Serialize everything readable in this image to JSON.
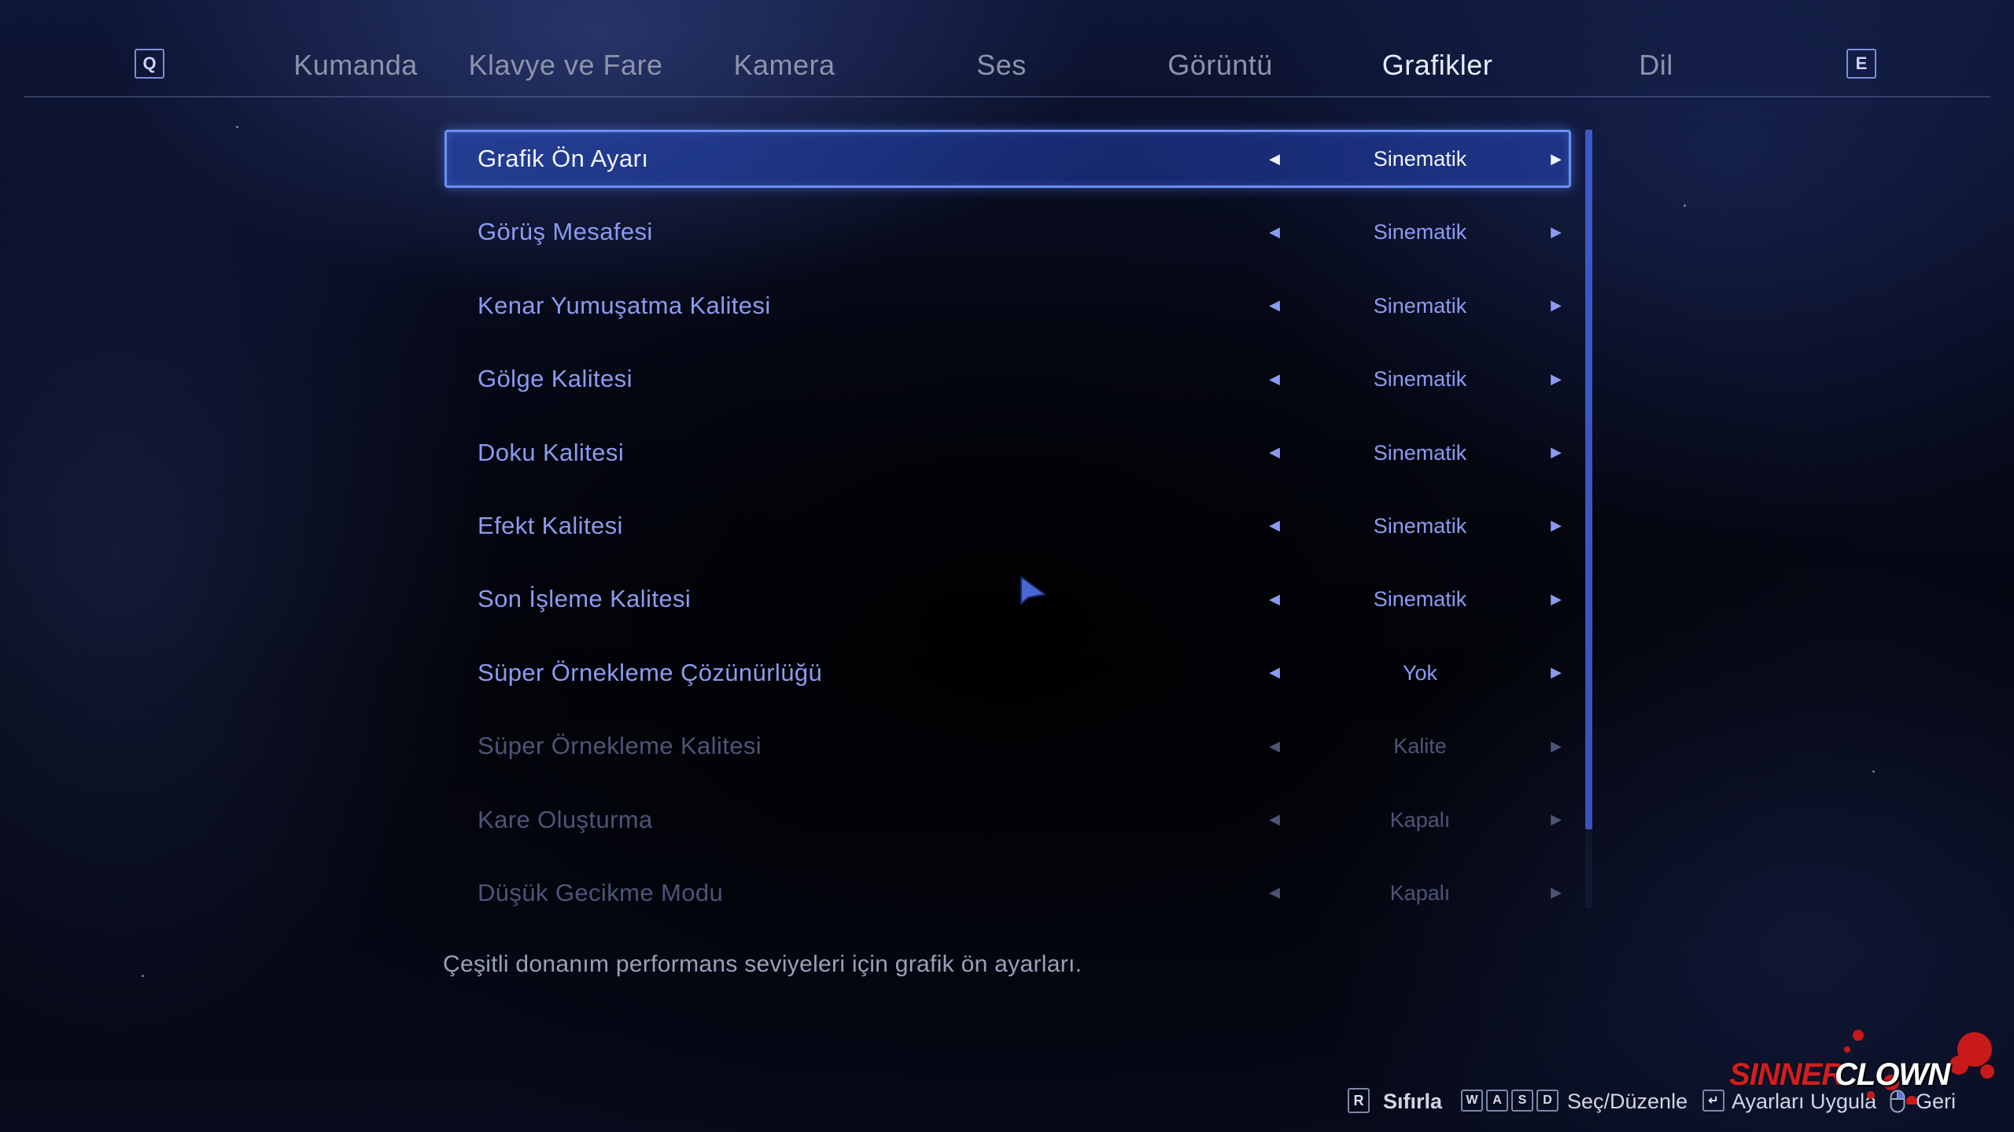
{
  "tabs": {
    "prev_key": "Q",
    "next_key": "E",
    "items": [
      {
        "label": "Kumanda"
      },
      {
        "label": "Klavye ve Fare"
      },
      {
        "label": "Kamera"
      },
      {
        "label": "Ses"
      },
      {
        "label": "Görüntü"
      },
      {
        "label": "Grafikler"
      },
      {
        "label": "Dil"
      }
    ],
    "active": "Grafikler"
  },
  "settings": [
    {
      "label": "Grafik Ön Ayarı",
      "value": "Sinematik",
      "state": "selected"
    },
    {
      "label": "Görüş Mesafesi",
      "value": "Sinematik",
      "state": "enabled"
    },
    {
      "label": "Kenar Yumuşatma Kalitesi",
      "value": "Sinematik",
      "state": "enabled"
    },
    {
      "label": "Gölge Kalitesi",
      "value": "Sinematik",
      "state": "enabled"
    },
    {
      "label": "Doku Kalitesi",
      "value": "Sinematik",
      "state": "enabled"
    },
    {
      "label": "Efekt Kalitesi",
      "value": "Sinematik",
      "state": "enabled"
    },
    {
      "label": "Son İşleme Kalitesi",
      "value": "Sinematik",
      "state": "enabled"
    },
    {
      "label": "Süper Örnekleme Çözünürlüğü",
      "value": "Yok",
      "state": "enabled"
    },
    {
      "label": "Süper Örnekleme Kalitesi",
      "value": "Kalite",
      "state": "disabled"
    },
    {
      "label": "Kare Oluşturma",
      "value": "Kapalı",
      "state": "disabled"
    },
    {
      "label": "Düşük Gecikme Modu",
      "value": "Kapalı",
      "state": "disabled"
    }
  ],
  "description": "Çeşitli donanım performans seviyeleri için grafik ön ayarları.",
  "hints": {
    "reset_key": "R",
    "reset_label": "Sıfırla",
    "move_keys": [
      "W",
      "A",
      "S",
      "D"
    ],
    "move_label": "Seç/Düzenle",
    "apply_key": "↵",
    "apply_label": "Ayarları Uygula",
    "back_label": "Geri"
  },
  "watermark": {
    "part1": "SINNER",
    "part2": "CLOWN"
  },
  "colors": {
    "accent": "#6d8ff5",
    "selected_row": "#2846aa",
    "enabled_text": "#8b9bf0",
    "disabled_text": "#4e5478",
    "watermark_red": "#d01e1e"
  },
  "icons": {
    "arrow_left": "caret-left-icon",
    "arrow_right": "caret-right-icon",
    "cursor": "mouse-pointer-icon",
    "back": "mouse-icon"
  }
}
